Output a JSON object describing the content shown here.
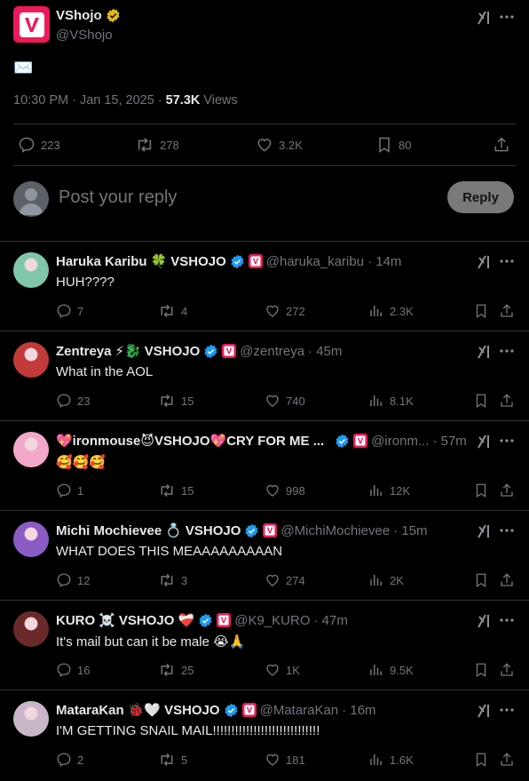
{
  "post": {
    "author_name": "VShojo",
    "author_handle": "@VShojo",
    "content": "✉️",
    "time": "10:30 PM · Jan 15, 2025 · ",
    "views_count": "57.3K",
    "views_label": "Views",
    "stats": {
      "replies": "223",
      "reposts": "278",
      "likes": "3.2K",
      "bookmarks": "80"
    }
  },
  "composer": {
    "placeholder": "Post your reply",
    "button": "Reply"
  },
  "replies": [
    {
      "name": "Haruka Karibu",
      "emoji": "🍀",
      "tag": "VSHOJO",
      "handle": "@haruka_karibu",
      "time": "· 14m",
      "text": "HUH????",
      "stats": [
        "7",
        "4",
        "272",
        "2.3K"
      ],
      "avatar_color": "#7fc7a8"
    },
    {
      "name": "Zentreya",
      "emoji": "⚡🐉",
      "tag": "VSHOJO",
      "handle": "@zentreya",
      "time": "· 45m",
      "text": "What in the AOL",
      "stats": [
        "23",
        "15",
        "740",
        "8.1K"
      ],
      "avatar_color": "#c23a3a"
    },
    {
      "name": "💖ironmouse😈VSHOJO💖CRY FOR ME ...",
      "emoji": "",
      "tag": "",
      "handle": "@ironm...",
      "time": "· 57m",
      "text": "🥰🥰🥰",
      "stats": [
        "1",
        "15",
        "998",
        "12K"
      ],
      "avatar_color": "#f2a8c8"
    },
    {
      "name": "Michi Mochievee",
      "emoji": "💍",
      "tag": "VSHOJO",
      "handle": "@MichiMochievee",
      "time": "· 15m",
      "text": "WHAT DOES THIS MEAAAAAAAAAN",
      "stats": [
        "12",
        "3",
        "274",
        "2K"
      ],
      "avatar_color": "#8a5cc4"
    },
    {
      "name": "KURO",
      "emoji": "☠️",
      "tag": "VSHOJO ❤️‍🩹",
      "handle": "@K9_KURO",
      "time": "· 47m",
      "text": "It's mail but can it be male 😭🙏",
      "stats": [
        "16",
        "25",
        "1K",
        "9.5K"
      ],
      "avatar_color": "#6b2a2a"
    },
    {
      "name": "MataraKan",
      "emoji": "🐞🤍",
      "tag": "VSHOJO",
      "handle": "@MataraKan",
      "time": "· 16m",
      "text": "I'M GETTING SNAIL MAIL!!!!!!!!!!!!!!!!!!!!!!!!!!!!!",
      "stats": [
        "2",
        "5",
        "181",
        "1.6K"
      ],
      "avatar_color": "#c9b7c8"
    }
  ]
}
